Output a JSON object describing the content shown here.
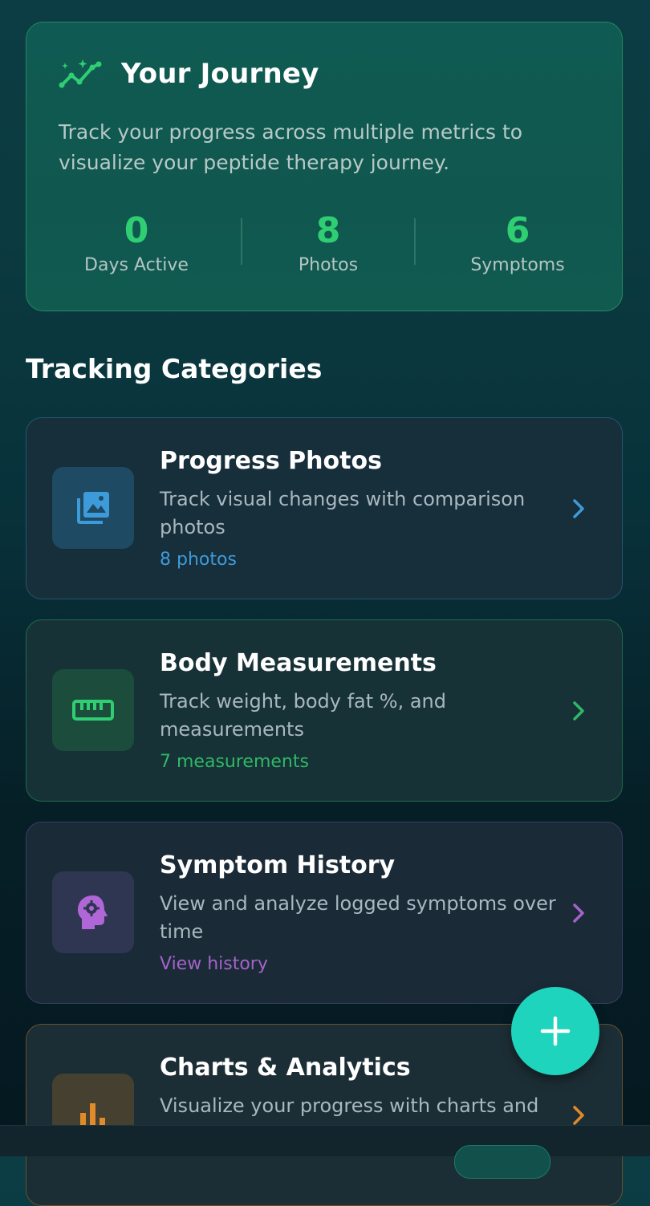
{
  "journey": {
    "title": "Your Journey",
    "description": "Track your progress across multiple metrics to visualize your peptide therapy journey.",
    "icon": "trending-sparkle-icon",
    "stats": [
      {
        "value": "0",
        "label": "Days Active"
      },
      {
        "value": "8",
        "label": "Photos"
      },
      {
        "value": "6",
        "label": "Symptoms"
      }
    ]
  },
  "section": {
    "title": "Tracking Categories"
  },
  "categories": [
    {
      "title": "Progress Photos",
      "description": "Track visual changes with comparison photos",
      "meta": "8 photos",
      "icon": "photo-library-icon",
      "accent": "#3e9bd9"
    },
    {
      "title": "Body Measurements",
      "description": "Track weight, body fat %, and measurements",
      "meta": "7 measurements",
      "icon": "ruler-icon",
      "accent": "#2fb866"
    },
    {
      "title": "Symptom History",
      "description": "View and analyze logged symptoms over time",
      "meta": "View history",
      "icon": "head-gear-icon",
      "accent": "#a463c9"
    },
    {
      "title": "Charts & Analytics",
      "description": "Visualize your progress with charts and",
      "meta": "",
      "icon": "bar-chart-icon",
      "accent": "#e08a2a"
    }
  ],
  "colors": {
    "accent_green": "#2fce73",
    "fab": "#1fd4bd"
  },
  "fab": {
    "icon": "plus-icon"
  }
}
